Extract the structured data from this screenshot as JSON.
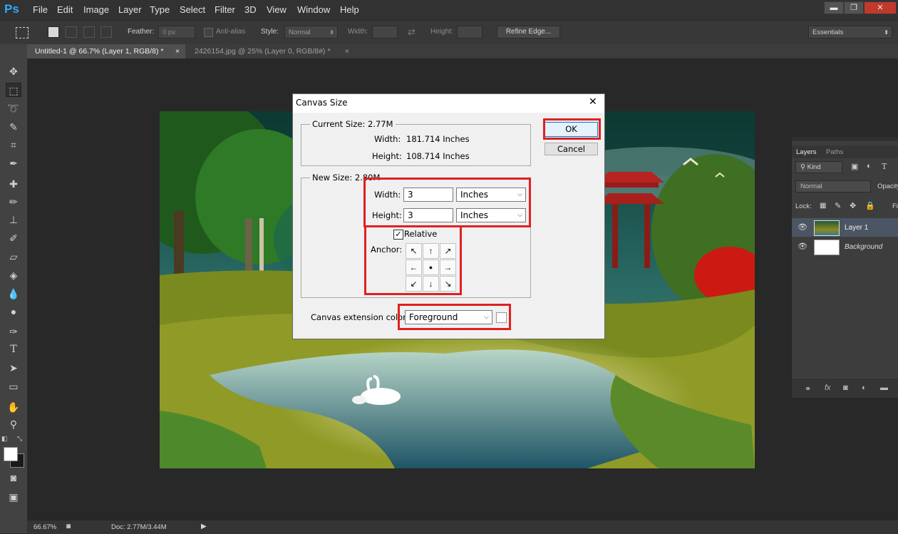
{
  "app": {
    "logo": "Ps"
  },
  "menu": [
    "File",
    "Edit",
    "Image",
    "Layer",
    "Type",
    "Select",
    "Filter",
    "3D",
    "View",
    "Window",
    "Help"
  ],
  "window_buttons": {
    "minimize": "▬",
    "restore": "❐",
    "close": "✕"
  },
  "options_bar": {
    "feather_label": "Feather:",
    "feather_value": "0 px",
    "antialias_label": "Anti-alias",
    "style_label": "Style:",
    "style_value": "Normal",
    "width_label": "Width:",
    "height_label": "Height:",
    "refine_edge": "Refine Edge...",
    "workspace": "Essentials"
  },
  "tabs": [
    {
      "label": "Untitled-1 @ 66.7% (Layer 1, RGB/8) *",
      "close": "×",
      "active": true
    },
    {
      "label": "2426154.jpg @ 25% (Layer 0, RGB/8#) *",
      "close": "×",
      "active": false
    }
  ],
  "status": {
    "zoom": "66.67%",
    "doc": "Doc: 2.77M/3.44M"
  },
  "dialog": {
    "title": "Canvas Size",
    "close": "✕",
    "current_size_label": "Current Size: 2.77M",
    "current_width_label": "Width:",
    "current_width_value": "181.714 Inches",
    "current_height_label": "Height:",
    "current_height_value": "108.714 Inches",
    "new_size_label": "New Size: 2.80M",
    "new_width_label": "Width:",
    "new_width_value": "3",
    "new_width_unit": "Inches",
    "new_height_label": "Height:",
    "new_height_value": "3",
    "new_height_unit": "Inches",
    "relative_label": "Relative",
    "relative_checked": true,
    "anchor_label": "Anchor:",
    "anchor_arrows": [
      "↖",
      "↑",
      "↗",
      "←",
      "●",
      "→",
      "↙",
      "↓",
      "↘"
    ],
    "extension_label": "Canvas extension color:",
    "extension_value": "Foreground",
    "ok": "OK",
    "cancel": "Cancel"
  },
  "layers_panel": {
    "tabs": [
      "Layers",
      "Paths"
    ],
    "filter_kind": "Kind",
    "blend_mode": "Normal",
    "opacity_label": "Opacity",
    "lock_label": "Lock:",
    "fill_label": "Fil",
    "layers": [
      {
        "name": "Layer 1",
        "selected": true
      },
      {
        "name": "Background",
        "selected": false
      }
    ],
    "footer_icons": [
      "link-icon",
      "fx-icon",
      "mask-icon",
      "adjustment-icon",
      "group-folder-icon"
    ]
  },
  "colors": {
    "accent": "#31a8ff",
    "highlight_box": "#e02020",
    "selected_layer": "#4c5563"
  }
}
